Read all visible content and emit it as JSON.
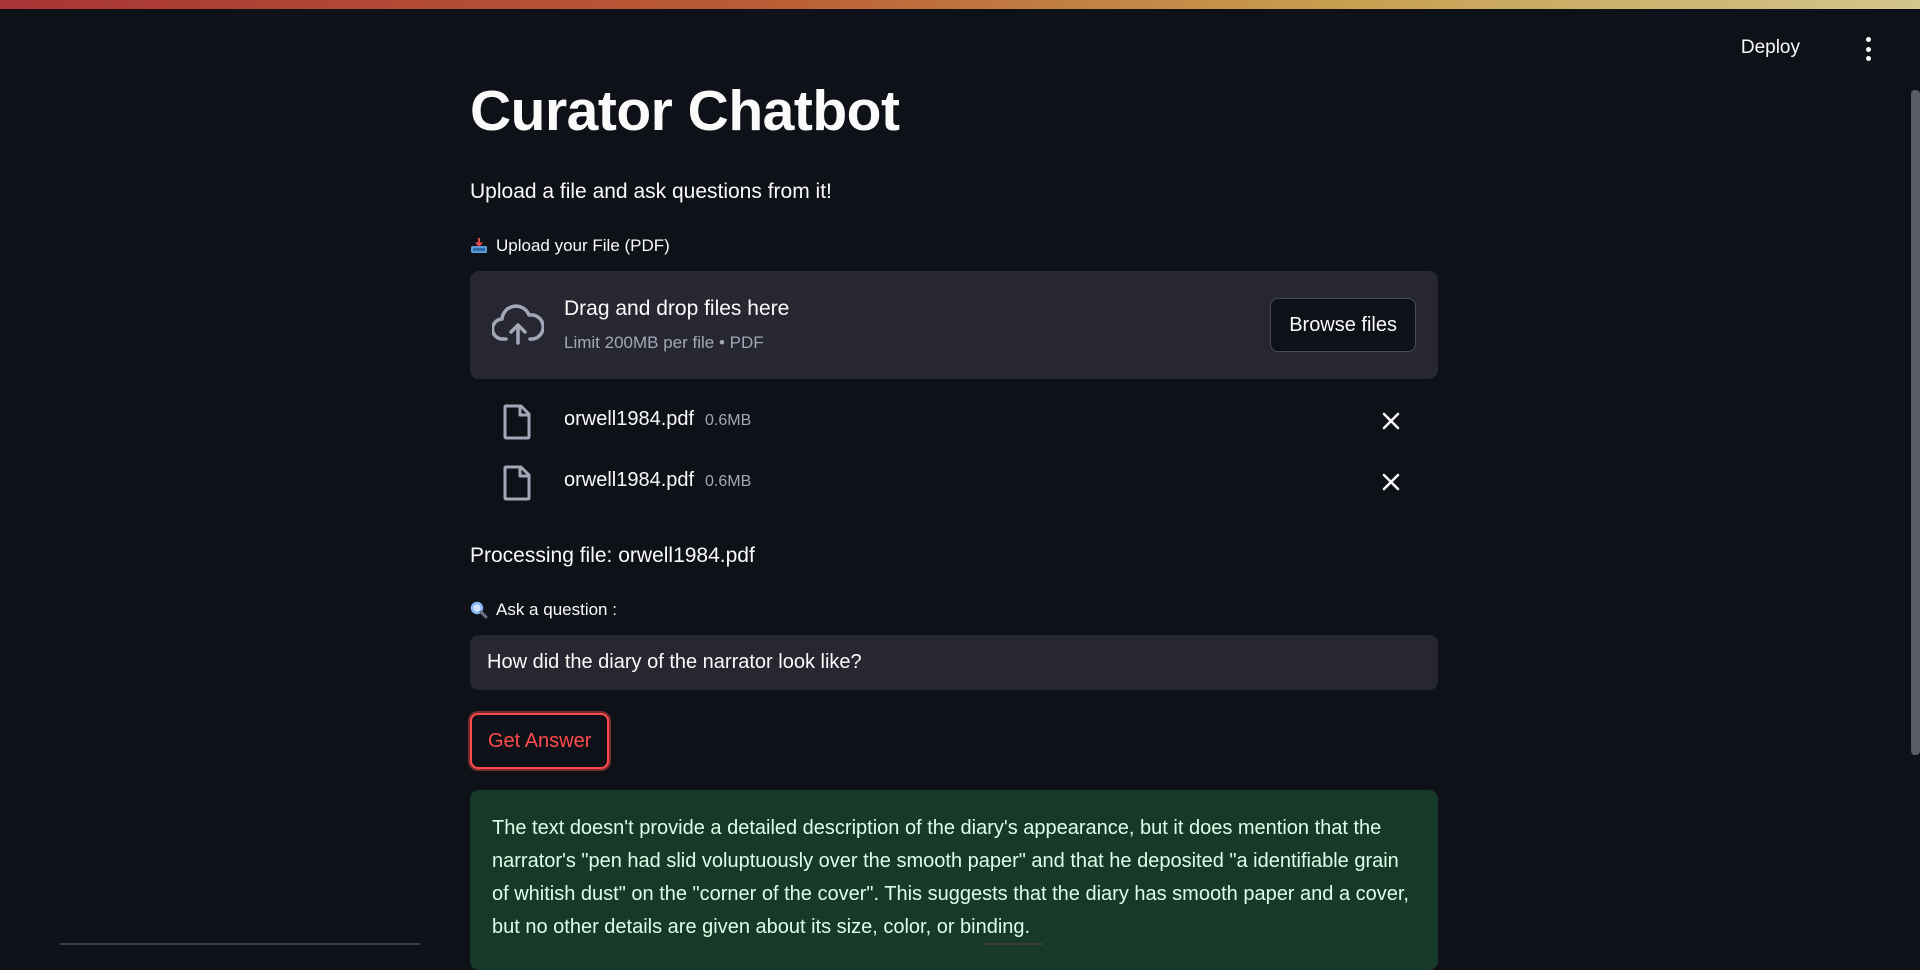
{
  "header": {
    "deploy_label": "Deploy",
    "menu_icon": "kebab-menu-icon"
  },
  "page": {
    "title": "Curator Chatbot",
    "subtitle": "Upload a file and ask questions from it!"
  },
  "uploader": {
    "label_icon": "inbox-tray-icon",
    "label": "Upload your File (PDF)",
    "drop_icon": "cloud-upload-icon",
    "drop_title": "Drag and drop files here",
    "drop_limit": "Limit 200MB per file • PDF",
    "browse_label": "Browse files",
    "files": [
      {
        "name": "orwell1984.pdf",
        "size": "0.6MB",
        "icon": "file-icon"
      },
      {
        "name": "orwell1984.pdf",
        "size": "0.6MB",
        "icon": "file-icon"
      }
    ]
  },
  "processing_text": "Processing file: orwell1984.pdf",
  "question": {
    "label_icon": "magnifier-icon",
    "label": "Ask a question :",
    "value": "How did the diary of the narrator look like?",
    "button_label": "Get Answer"
  },
  "answer": {
    "text": "The text doesn't provide a detailed description of the diary's appearance, but it does mention that the narrator's \"pen had slid voluptuously over the smooth paper\" and that he deposited \"a identifiable grain of whitish dust\" on the \"corner of the cover\". This suggests that the diary has smooth paper and a cover, but no other details are given about its size, color, or binding."
  },
  "colors": {
    "background": "#0e1117",
    "surface": "#262730",
    "accent": "#ff4b4b",
    "success_bg": "#173928",
    "success_text": "#dffde9"
  }
}
